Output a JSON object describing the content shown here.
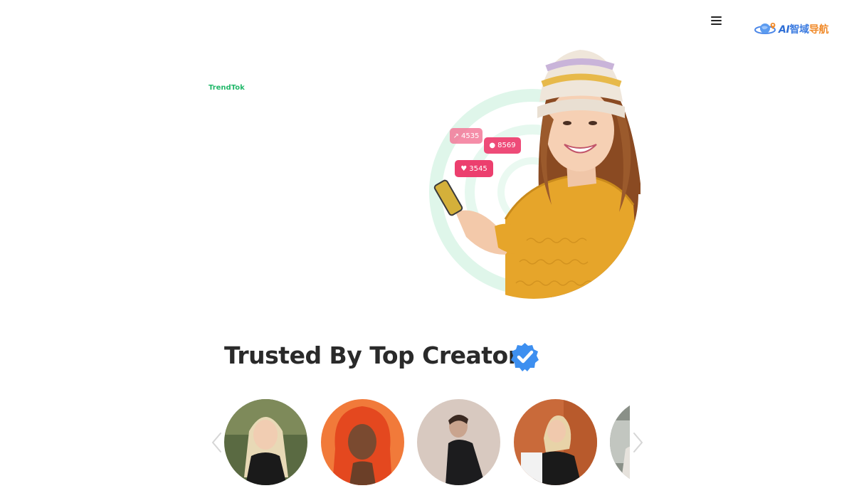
{
  "header": {
    "menu_icon": "hamburger-menu-icon",
    "logo": {
      "ai": "AI",
      "cn_part1": "智域",
      "cn_part2": "导航"
    }
  },
  "brand": {
    "name": "TrendTok",
    "color": "#22b86a"
  },
  "hero": {
    "badges": [
      {
        "icon": "trend-arrow-icon",
        "value": "4535"
      },
      {
        "icon": "user-icon",
        "value": "8569"
      },
      {
        "icon": "heart-icon",
        "value": "3545"
      }
    ],
    "accent_color": "#e83e6d",
    "ring_color": "#d9f5e8"
  },
  "trusted": {
    "title": "Trusted By Top Creators",
    "badge_icon": "verified-check-icon",
    "badge_color": "#3d8ff0"
  },
  "carousel": {
    "prev_icon": "chevron-left-icon",
    "next_icon": "chevron-right-icon",
    "creators": [
      {
        "name": "creator-1"
      },
      {
        "name": "creator-2"
      },
      {
        "name": "creator-3"
      },
      {
        "name": "creator-4"
      },
      {
        "name": "creator-5"
      }
    ]
  }
}
